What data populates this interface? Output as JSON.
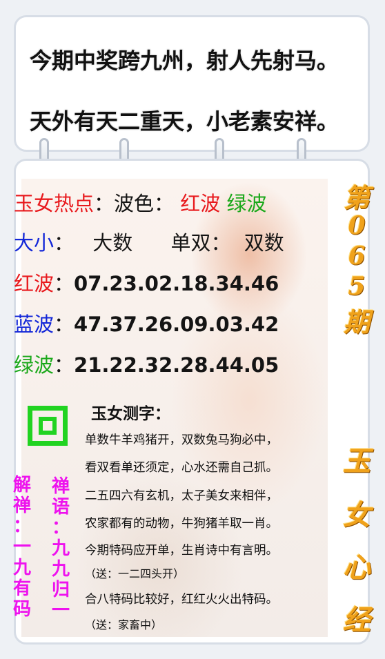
{
  "header": {
    "line1": "今期中奖跨九州，射人先射马。",
    "line2": "天外有天二重天，小老素安祥。"
  },
  "hot": {
    "label": "玉女热点",
    "colon": "：",
    "wave_label": "波色：",
    "wave_red": "红波",
    "wave_green": "绿波"
  },
  "size_row": {
    "label": "大小",
    "colon": "：",
    "size_value": "大数",
    "parity_label": "单双：",
    "parity_value": "双数"
  },
  "red_row": {
    "label": "红波",
    "colon": "：",
    "numbers": "07.23.02.18.34.46"
  },
  "blue_row": {
    "label": "蓝波",
    "colon": "：",
    "numbers": "47.37.26.09.03.42"
  },
  "green_row": {
    "label": "绿波",
    "colon": "：",
    "numbers": "21.22.32.28.44.05"
  },
  "zen": {
    "left_col": [
      "解",
      "禅",
      "：",
      "一",
      "九",
      "有",
      "码"
    ],
    "right_col": [
      "禅",
      "语",
      "：",
      "九",
      "九",
      "归",
      "一"
    ]
  },
  "test": {
    "title": "玉女测字：",
    "lines": [
      "单数牛羊鸡猪开，双数兔马狗必中，",
      "看双看单还须定，心水还需自己抓。",
      "二五四六有玄机，太子美女来相伴，",
      "农家都有的动物，牛狗猪羊取一肖。",
      "今期特码应开单，生肖诗中有言明。",
      "（送：一二四头开）",
      "合八特码比较好，红红火火出特码。",
      "（送：家畜中）"
    ]
  },
  "issue": [
    "第",
    "0",
    "6",
    "5",
    "期"
  ],
  "brand": [
    "玉",
    "女",
    "心",
    "经"
  ],
  "colors": {
    "red": "#e8191d",
    "green": "#1aa81a",
    "blue": "#1226d8",
    "magenta": "#ee12ee",
    "gold": "#f0a21b",
    "logo_green": "#21d321"
  },
  "icons": [
    "binder-ring",
    "square-logo"
  ]
}
